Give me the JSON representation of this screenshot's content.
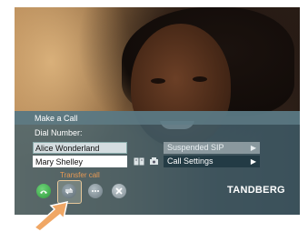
{
  "panel": {
    "title": "Make a Call",
    "dial_label": "Dial Number:",
    "entries": [
      "Alice Wonderland",
      "Mary Shelley"
    ],
    "menu": [
      {
        "label": "Suspended SIP",
        "enabled": false
      },
      {
        "label": "Call Settings",
        "enabled": true
      }
    ],
    "arrow_glyph": "▶",
    "tooltip": "Transfer call",
    "logo": "TANDBERG"
  },
  "colors": {
    "tooltip": "#e89a55",
    "call_button": "#2f9a3c",
    "highlight_frame": "#e6c79a",
    "pointer_arrow": "#f0a765"
  },
  "icons": [
    "phonebook-icon",
    "directory-icon",
    "call-icon",
    "transfer-call-icon",
    "keypad-icon",
    "settings-icon",
    "pointer-arrow-icon"
  ]
}
